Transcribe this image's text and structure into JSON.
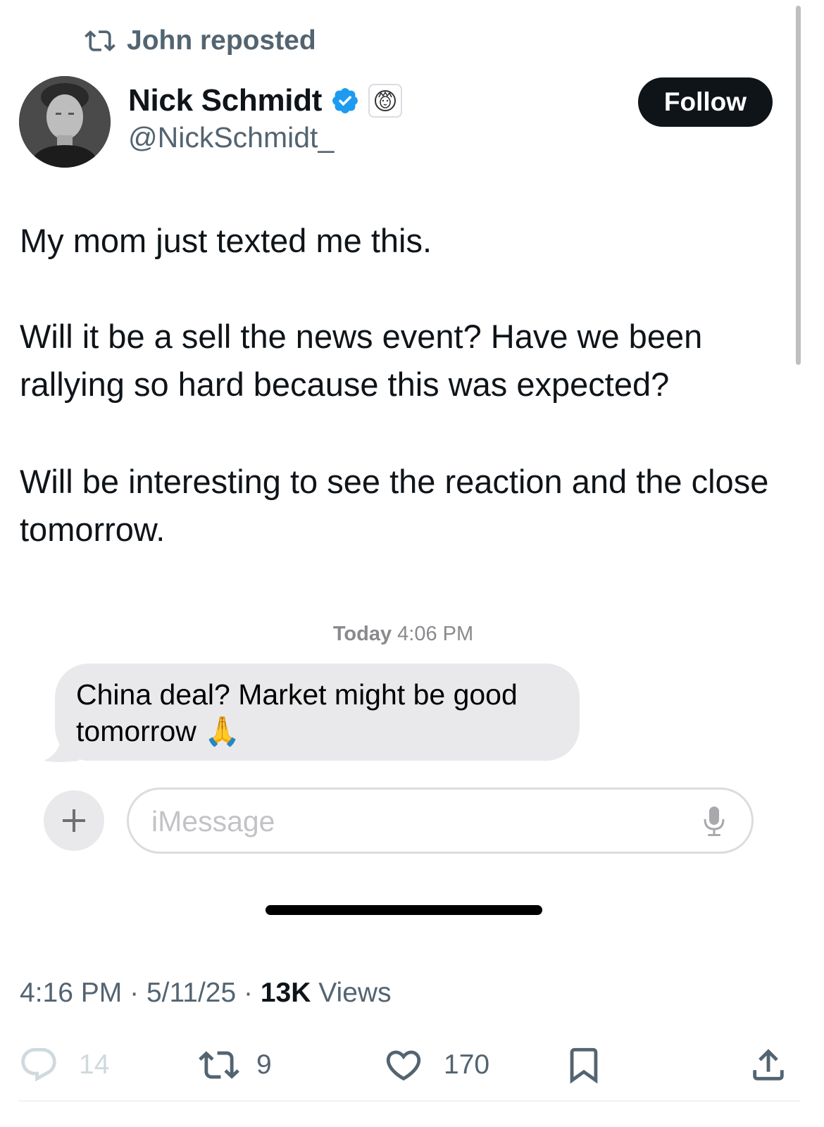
{
  "repost": {
    "label": "John reposted",
    "icon": "repost-icon"
  },
  "author": {
    "name": "Nick Schmidt",
    "handle": "@NickSchmidt_",
    "verified_icon": "verified-badge-icon",
    "org_badge_icon": "lion-icon"
  },
  "follow_label": "Follow",
  "tweet": {
    "p1": "My mom just texted me this.",
    "p2": "Will it be a sell the news event? Have we been rallying so hard because this was expected?",
    "p3": "Will be interesting to see the reaction and the close tomorrow."
  },
  "imessage": {
    "day": "Today",
    "time": "4:06 PM",
    "bubble_text": "China deal?  Market might be good tomorrow 🙏",
    "input_placeholder": "iMessage",
    "plus_icon": "plus-icon",
    "mic_icon": "microphone-icon"
  },
  "meta": {
    "time": "4:16 PM",
    "date": "5/11/25",
    "views_count": "13K",
    "views_label": "Views",
    "separator": "·"
  },
  "actions": {
    "replies": "14",
    "reposts": "9",
    "likes": "170"
  },
  "colors": {
    "accent": "#1d9bf0",
    "text": "#0f1419",
    "secondary": "#536471",
    "bubble": "#e9e9eb"
  }
}
